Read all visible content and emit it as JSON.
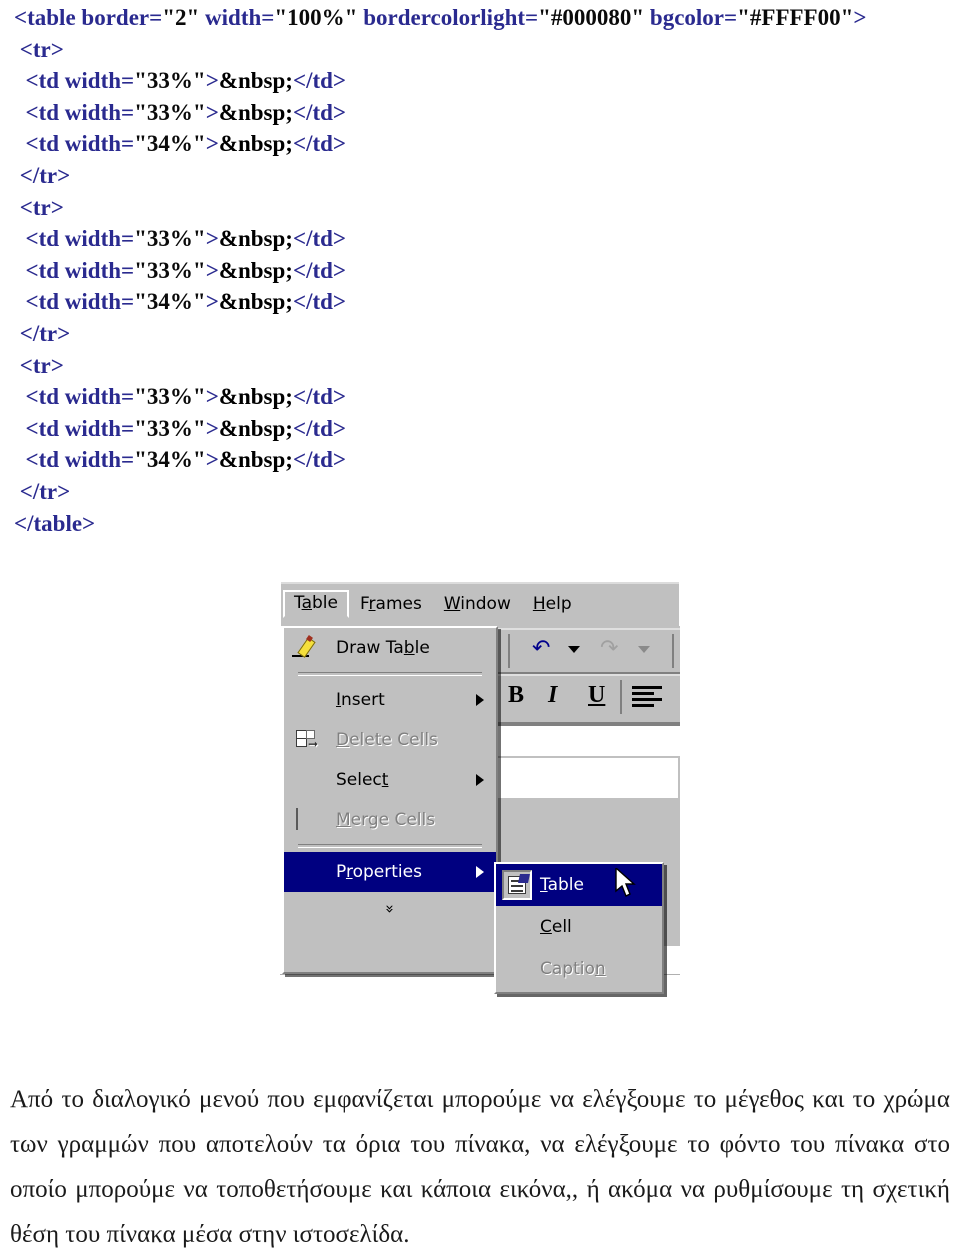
{
  "code_block": {
    "name": "html-table-source-code",
    "lines": [
      {
        "indent": 0,
        "parts": [
          {
            "t": "<table border=",
            "c": "tag"
          },
          {
            "t": "\"2\"",
            "c": "val"
          },
          {
            "t": " width=",
            "c": "tag"
          },
          {
            "t": "\"100%\"",
            "c": "val"
          },
          {
            "t": " bordercolorlight=",
            "c": "tag"
          },
          {
            "t": "\"#000080\"",
            "c": "val"
          },
          {
            "t": " bgcolor=",
            "c": "tag"
          },
          {
            "t": "\"#FFFF00\"",
            "c": "val"
          },
          {
            "t": ">",
            "c": "tag"
          }
        ]
      },
      {
        "indent": 1,
        "parts": [
          {
            "t": "<tr>",
            "c": "tag"
          }
        ]
      },
      {
        "indent": 2,
        "parts": [
          {
            "t": "<td width=",
            "c": "tag"
          },
          {
            "t": "\"33%\"",
            "c": "val"
          },
          {
            "t": ">",
            "c": "tag"
          },
          {
            "t": "&nbsp;",
            "c": "ent"
          },
          {
            "t": "</td>",
            "c": "tag"
          }
        ]
      },
      {
        "indent": 2,
        "parts": [
          {
            "t": "<td width=",
            "c": "tag"
          },
          {
            "t": "\"33%\"",
            "c": "val"
          },
          {
            "t": ">",
            "c": "tag"
          },
          {
            "t": "&nbsp;",
            "c": "ent"
          },
          {
            "t": "</td>",
            "c": "tag"
          }
        ]
      },
      {
        "indent": 2,
        "parts": [
          {
            "t": "<td width=",
            "c": "tag"
          },
          {
            "t": "\"34%\"",
            "c": "val"
          },
          {
            "t": ">",
            "c": "tag"
          },
          {
            "t": "&nbsp;",
            "c": "ent"
          },
          {
            "t": "</td>",
            "c": "tag"
          }
        ]
      },
      {
        "indent": 1,
        "parts": [
          {
            "t": "</tr>",
            "c": "tag"
          }
        ]
      },
      {
        "indent": 1,
        "parts": [
          {
            "t": "<tr>",
            "c": "tag"
          }
        ]
      },
      {
        "indent": 2,
        "parts": [
          {
            "t": "<td width=",
            "c": "tag"
          },
          {
            "t": "\"33%\"",
            "c": "val"
          },
          {
            "t": ">",
            "c": "tag"
          },
          {
            "t": "&nbsp;",
            "c": "ent"
          },
          {
            "t": "</td>",
            "c": "tag"
          }
        ]
      },
      {
        "indent": 2,
        "parts": [
          {
            "t": "<td width=",
            "c": "tag"
          },
          {
            "t": "\"33%\"",
            "c": "val"
          },
          {
            "t": ">",
            "c": "tag"
          },
          {
            "t": "&nbsp;",
            "c": "ent"
          },
          {
            "t": "</td>",
            "c": "tag"
          }
        ]
      },
      {
        "indent": 2,
        "parts": [
          {
            "t": "<td width=",
            "c": "tag"
          },
          {
            "t": "\"34%\"",
            "c": "val"
          },
          {
            "t": ">",
            "c": "tag"
          },
          {
            "t": "&nbsp;",
            "c": "ent"
          },
          {
            "t": "</td>",
            "c": "tag"
          }
        ]
      },
      {
        "indent": 1,
        "parts": [
          {
            "t": "</tr>",
            "c": "tag"
          }
        ]
      },
      {
        "indent": 1,
        "parts": [
          {
            "t": "<tr>",
            "c": "tag"
          }
        ]
      },
      {
        "indent": 2,
        "parts": [
          {
            "t": "<td width=",
            "c": "tag"
          },
          {
            "t": "\"33%\"",
            "c": "val"
          },
          {
            "t": ">",
            "c": "tag"
          },
          {
            "t": "&nbsp;",
            "c": "ent"
          },
          {
            "t": "</td>",
            "c": "tag"
          }
        ]
      },
      {
        "indent": 2,
        "parts": [
          {
            "t": "<td width=",
            "c": "tag"
          },
          {
            "t": "\"33%\"",
            "c": "val"
          },
          {
            "t": ">",
            "c": "tag"
          },
          {
            "t": "&nbsp;",
            "c": "ent"
          },
          {
            "t": "</td>",
            "c": "tag"
          }
        ]
      },
      {
        "indent": 2,
        "parts": [
          {
            "t": "<td width=",
            "c": "tag"
          },
          {
            "t": "\"34%\"",
            "c": "val"
          },
          {
            "t": ">",
            "c": "tag"
          },
          {
            "t": "&nbsp;",
            "c": "ent"
          },
          {
            "t": "</td>",
            "c": "tag"
          }
        ]
      },
      {
        "indent": 1,
        "parts": [
          {
            "t": "</tr>",
            "c": "tag"
          }
        ]
      },
      {
        "indent": 0,
        "parts": [
          {
            "t": "</table>",
            "c": "tag"
          }
        ]
      }
    ],
    "colors": {
      "tag": "#2a2a8f",
      "value": "#0a0a0a",
      "entity": "#000000"
    }
  },
  "figure": {
    "name": "frontpage-table-properties-menu-screenshot",
    "menubar": {
      "items": [
        {
          "label": "Table",
          "pre": "T",
          "accel": "a",
          "post": "ble",
          "active": true
        },
        {
          "label": "Frames",
          "pre": "F",
          "accel": "r",
          "post": "ames",
          "active": false
        },
        {
          "label": "Window",
          "pre": "",
          "accel": "W",
          "post": "indow",
          "active": false
        },
        {
          "label": "Help",
          "pre": "",
          "accel": "H",
          "post": "elp",
          "active": false
        }
      ]
    },
    "dropdown": {
      "items": [
        {
          "kind": "item",
          "label": "Draw Table",
          "pre": "Draw Ta",
          "accel": "b",
          "post": "le",
          "icon": "pencil-icon",
          "disabled": false,
          "selected": false,
          "submenu": false
        },
        {
          "kind": "separator"
        },
        {
          "kind": "item",
          "label": "Insert",
          "pre": "",
          "accel": "I",
          "post": "nsert",
          "icon": null,
          "disabled": false,
          "selected": false,
          "submenu": true
        },
        {
          "kind": "item",
          "label": "Delete Cells",
          "pre": "",
          "accel": "D",
          "post": "elete Cells",
          "icon": "delete-cells-icon",
          "disabled": true,
          "selected": false,
          "submenu": false
        },
        {
          "kind": "item",
          "label": "Select",
          "pre": "Selec",
          "accel": "t",
          "post": "",
          "icon": null,
          "disabled": false,
          "selected": false,
          "submenu": true
        },
        {
          "kind": "item",
          "label": "Merge Cells",
          "pre": "",
          "accel": "M",
          "post": "erge Cells",
          "icon": "merge-cells-icon",
          "disabled": true,
          "selected": false,
          "submenu": false
        },
        {
          "kind": "separator"
        },
        {
          "kind": "item",
          "label": "Properties",
          "pre": "P",
          "accel": "r",
          "post": "operties",
          "icon": null,
          "disabled": false,
          "selected": true,
          "submenu": true
        },
        {
          "kind": "expand",
          "label": "»"
        }
      ]
    },
    "submenu": {
      "items": [
        {
          "label": "Table",
          "pre": "",
          "accel": "T",
          "post": "able",
          "icon": "table-properties-icon",
          "disabled": false,
          "selected": true
        },
        {
          "label": "Cell",
          "pre": "",
          "accel": "C",
          "post": "ell",
          "icon": null,
          "disabled": false,
          "selected": false
        },
        {
          "label": "Caption",
          "pre": "Captio",
          "accel": "n",
          "post": "",
          "icon": null,
          "disabled": true,
          "selected": false
        }
      ]
    },
    "toolbar": {
      "buttons": [
        {
          "name": "undo-button",
          "glyph": "↶",
          "state": "enabled"
        },
        {
          "name": "undo-dropdown-caret",
          "glyph": "▼",
          "state": "enabled"
        },
        {
          "name": "redo-button",
          "glyph": "↷",
          "state": "disabled"
        },
        {
          "name": "redo-dropdown-caret",
          "glyph": "▼",
          "state": "disabled"
        },
        {
          "name": "bold-button",
          "glyph": "B",
          "state": "enabled"
        },
        {
          "name": "italic-button",
          "glyph": "I",
          "state": "enabled"
        },
        {
          "name": "underline-button",
          "glyph": "U",
          "state": "enabled"
        },
        {
          "name": "align-left-button",
          "glyph": "align",
          "state": "enabled"
        }
      ]
    },
    "colors": {
      "face": "#c0c0c0",
      "highlight": "#000080",
      "highlight_text": "#ffffff",
      "disabled_text": "#808080",
      "light_edge": "#ffffff",
      "dark_edge": "#808080"
    }
  },
  "caption": {
    "name": "greek-caption-paragraph",
    "text": "Από το διαλογικό μενού που εμφανίζεται μπορούμε να ελέγξουμε το μέγεθος και το χρώμα των γραμμών που αποτελούν τα όρια του πίνακα, να ελέγξουμε το φόντο του πίνακα στο οποίο μπορούμε να τοποθετήσουμε και κάποια εικόνα,, ή ακόμα να ρυθμίσουμε τη σχετική θέση του πίνακα μέσα στην ιστοσελίδα."
  }
}
